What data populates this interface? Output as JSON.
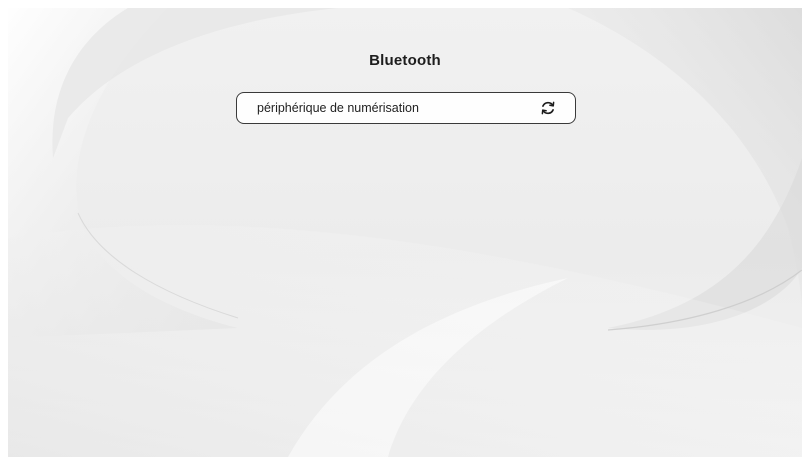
{
  "screen": {
    "title": "Bluetooth"
  },
  "scan_button": {
    "label": "périphérique de numérisation",
    "icon": "refresh-icon"
  },
  "colors": {
    "background": "#ececec",
    "text": "#1d1d1d",
    "border": "#3a3a3a"
  }
}
